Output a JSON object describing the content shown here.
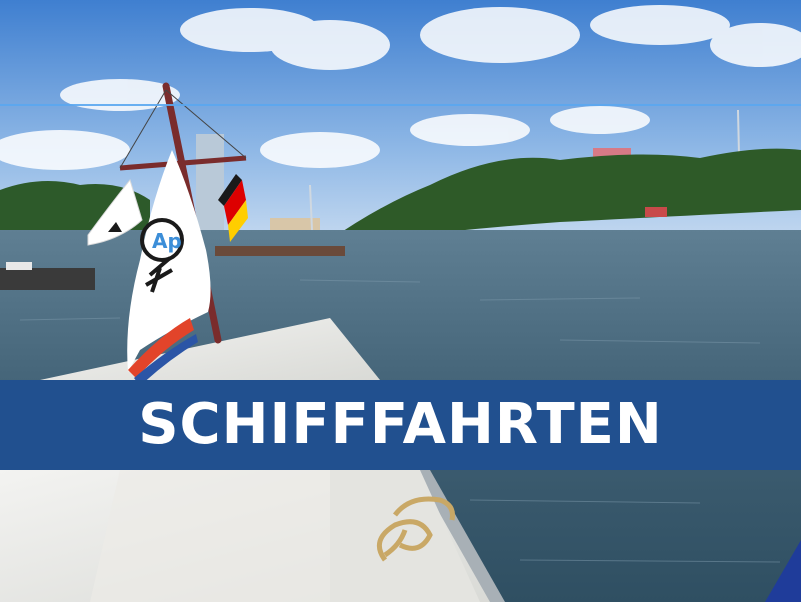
{
  "banner": {
    "title": "SCHIFFFAHRTEN",
    "background_color": "#21508f",
    "text_color": "#ffffff"
  },
  "guide_line_color": "#5aa7f0",
  "scene_icons": {
    "flags": [
      "white-flag-icon",
      "club-logo-pennant-icon",
      "german-flag-icon"
    ],
    "objects": [
      "sailboat-bow",
      "mast",
      "coiled-rope",
      "river",
      "wooded-shore",
      "city-skyline"
    ]
  }
}
